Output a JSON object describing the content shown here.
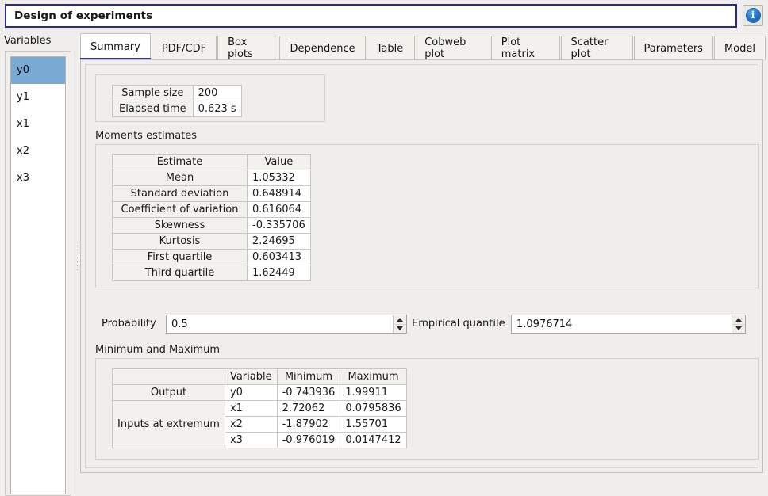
{
  "window": {
    "title": "Design of experiments",
    "info_icon": "info-icon",
    "info_glyph": "i"
  },
  "sidebar": {
    "label": "Variables",
    "items": [
      {
        "label": "y0",
        "selected": true
      },
      {
        "label": "y1",
        "selected": false
      },
      {
        "label": "x1",
        "selected": false
      },
      {
        "label": "x2",
        "selected": false
      },
      {
        "label": "x3",
        "selected": false
      }
    ]
  },
  "tabs": [
    {
      "label": "Summary",
      "active": true
    },
    {
      "label": "PDF/CDF",
      "active": false
    },
    {
      "label": "Box plots",
      "active": false
    },
    {
      "label": "Dependence",
      "active": false
    },
    {
      "label": "Table",
      "active": false
    },
    {
      "label": "Cobweb plot",
      "active": false
    },
    {
      "label": "Plot matrix",
      "active": false
    },
    {
      "label": "Scatter plot",
      "active": false
    },
    {
      "label": "Parameters",
      "active": false
    },
    {
      "label": "Model",
      "active": false
    }
  ],
  "summary": {
    "info_table": {
      "rows": [
        {
          "key": "Sample size",
          "value": "200"
        },
        {
          "key": "Elapsed time",
          "value": "0.623 s"
        }
      ]
    },
    "moments_section_label": "Moments estimates",
    "moments_table": {
      "headers": [
        "Estimate",
        "Value"
      ],
      "rows": [
        {
          "estimate": "Mean",
          "value": "1.05332"
        },
        {
          "estimate": "Standard deviation",
          "value": "0.648914"
        },
        {
          "estimate": "Coefficient of variation",
          "value": "0.616064"
        },
        {
          "estimate": "Skewness",
          "value": "-0.335706"
        },
        {
          "estimate": "Kurtosis",
          "value": "2.24695"
        },
        {
          "estimate": "First quartile",
          "value": "0.603413"
        },
        {
          "estimate": "Third quartile",
          "value": "1.62449"
        }
      ]
    },
    "probability": {
      "label": "Probability",
      "value": "0.5"
    },
    "empirical_quantile": {
      "label": "Empirical quantile",
      "value": "1.0976714"
    },
    "minmax_section_label": "Minimum and Maximum",
    "minmax_table": {
      "corner": "",
      "headers": [
        "Variable",
        "Minimum",
        "Maximum"
      ],
      "output_label": "Output",
      "inputs_label": "Inputs at extremum",
      "rows": [
        {
          "group": "Output",
          "variable": "y0",
          "minimum": "-0.743936",
          "maximum": "1.99911"
        },
        {
          "group": "Inputs at extremum",
          "variable": "x1",
          "minimum": "2.72062",
          "maximum": "0.0795836"
        },
        {
          "group": "Inputs at extremum",
          "variable": "x2",
          "minimum": "-1.87902",
          "maximum": "1.55701"
        },
        {
          "group": "Inputs at extremum",
          "variable": "x3",
          "minimum": "-0.976019",
          "maximum": "0.0147412"
        }
      ]
    }
  },
  "colors": {
    "accent": "#353591",
    "selection": "#7aa9d4",
    "window_bg": "#efeeec",
    "title_border": "#2a2a8c"
  }
}
